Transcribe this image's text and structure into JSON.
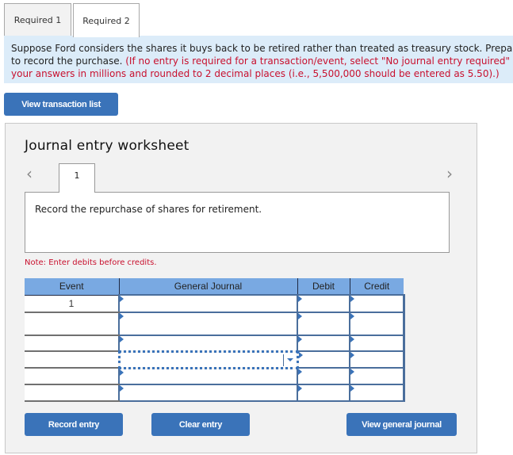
{
  "tabs": [
    {
      "label": "Required 1",
      "active": false
    },
    {
      "label": "Required 2",
      "active": true
    }
  ],
  "instructions": {
    "line1": "Suppose Ford considers the shares it buys back to be retired rather than treated as treasury stock. Prepare",
    "line2_black": "to record the purchase. ",
    "line2_red": "(If no entry is required for a transaction/event, select \"No journal entry required\" in",
    "line3_red": "your answers in millions and rounded to 2 decimal places (i.e., 5,500,000 should be entered as 5.50).)",
    "accent_color": "#c8102e",
    "background_color": "#dcecf9"
  },
  "buttons": {
    "view_transaction_list": "View transaction list",
    "record_entry": "Record entry",
    "clear_entry": "Clear entry",
    "view_general_journal": "View general journal",
    "color": "#3a73b9"
  },
  "worksheet": {
    "title": "Journal entry worksheet",
    "prev_icon": "chevron-left-icon",
    "next_icon": "chevron-right-icon",
    "current_page": "1",
    "description": "Record the repurchase of shares for retirement.",
    "note": "Note: Enter debits before credits."
  },
  "table": {
    "headers": {
      "event": "Event",
      "general_journal": "General Journal",
      "debit": "Debit",
      "credit": "Credit"
    },
    "header_color": "#79a9e2",
    "rows": [
      {
        "event": "1",
        "account": "",
        "debit": "",
        "credit": ""
      },
      {
        "event": "",
        "account": "",
        "debit": "",
        "credit": ""
      },
      {
        "event": "",
        "account": "",
        "debit": "",
        "credit": ""
      },
      {
        "event": "",
        "account": "",
        "debit": "",
        "credit": "",
        "focused": true
      },
      {
        "event": "",
        "account": "",
        "debit": "",
        "credit": ""
      },
      {
        "event": "",
        "account": "",
        "debit": "",
        "credit": ""
      }
    ]
  }
}
